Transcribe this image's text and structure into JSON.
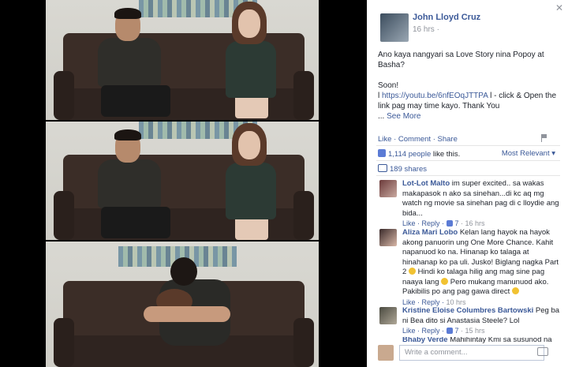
{
  "post": {
    "author": "John Lloyd Cruz",
    "time": "16 hrs",
    "time_suffix": "·",
    "text_line1": "Ano kaya nangyari sa Love Story nina Popoy at Basha?",
    "text_soon": "Soon!",
    "text_link_prefix": "l ",
    "link": "https://youtu.be/6nfEOqJTTPA",
    "text_after_link": " l - click & Open the link pag may time kayo. Thank You",
    "ellipsis": "... ",
    "see_more": "See More"
  },
  "actions": {
    "like": "Like",
    "dot1": " · ",
    "comment": "Comment",
    "dot2": " · ",
    "share": "Share"
  },
  "stats": {
    "likes_count": "1,114 people",
    "likes_suffix": " like this.",
    "sort": "Most Relevant ▾",
    "shares": "189 shares"
  },
  "comments": [
    {
      "name": "Lot-Lot Malto",
      "text": " im super excited.. sa wakas makapasok n ako sa sinehan...di kc aq mg watch ng movie sa sinehan pag di c lloydie ang bida...",
      "actions": "Like · Reply · ",
      "likes": "7",
      "time": " · 16 hrs"
    },
    {
      "name": "Aliza Mari Lobo",
      "text": " Kelan lang hayok na hayok akong panuorin ung One More Chance. Kahit napanuod ko na. Hinanap ko talaga at hinahanap ko pa uli. Jusko! Biglang nagka Part 2 ",
      "text2": " Hindi ko talaga hilig ang mag sine pag naaya lang ",
      "text3": " Pero mukang manunuod ako. Pakibilis po ang pag gawa direct ",
      "actions": "Like · Reply · ",
      "time": "10 hrs"
    },
    {
      "name": "Kristine Eloise Columbres Bartowski",
      "text": " Peg ba ni Bea dito si Anastasia Steele? Lol",
      "actions": "Like · Reply · ",
      "likes": "7",
      "time": " · 15 hrs"
    },
    {
      "name": "Bhaby Verde",
      "text": " Mahihintay Kmi sa susunod na"
    }
  ],
  "composer": {
    "placeholder": "Write a comment..."
  },
  "colors": {
    "link": "#3b5998",
    "muted": "#90949c"
  }
}
